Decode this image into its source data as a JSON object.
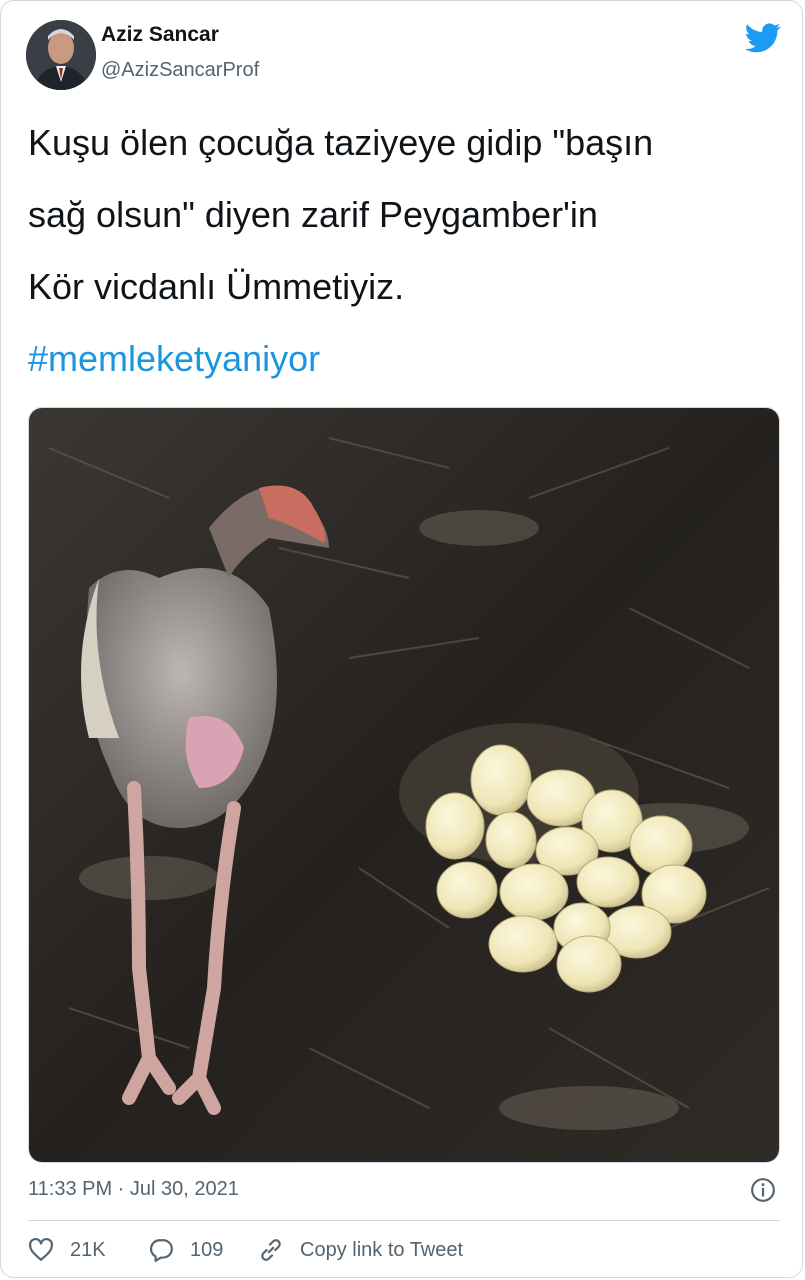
{
  "author": {
    "name": "Aziz Sancar",
    "handle": "@AzizSancarProf"
  },
  "tweet": {
    "lines": [
      "Kuşu ölen çocuğa taziyeye gidip \"başın",
      "sağ olsun\" diyen zarif Peygamber'in",
      "Kör vicdanlı Ümmetiyiz."
    ],
    "hashtag": "#memleketyaniyor"
  },
  "meta": {
    "timestamp": "11:33 PM · Jul 30, 2021"
  },
  "actions": {
    "like_count": "21K",
    "reply_count": "109",
    "copy_link_label": "Copy link to Tweet"
  },
  "icons": {
    "logo": "twitter-bird-icon",
    "info": "info-icon",
    "like": "heart-icon",
    "reply": "reply-bubble-icon",
    "copy": "link-icon"
  },
  "colors": {
    "accent": "#1d9bf0",
    "hashtag": "#1b95e0",
    "secondary_text": "#536471"
  }
}
